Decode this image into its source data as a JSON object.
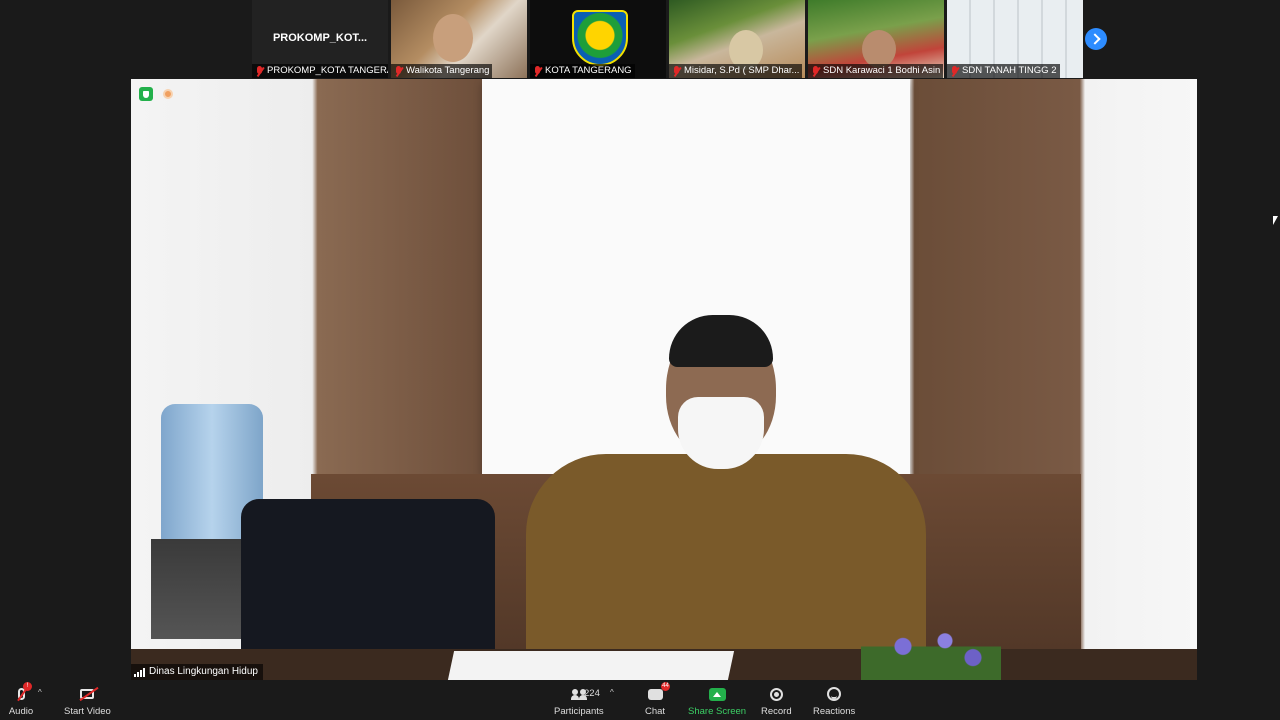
{
  "thumbnails": [
    {
      "title": "PROKOMP_KOT...",
      "name": "PROKOMP_KOTA TANGERA..."
    },
    {
      "name": "Walikota Tangerang"
    },
    {
      "name": "KOTA TANGERANG"
    },
    {
      "name": "Misidar, S.Pd ( SMP Dhar..."
    },
    {
      "name": "SDN Karawaci 1 Bodhi Asin"
    },
    {
      "name": "SDN TANAH TINGG 2"
    }
  ],
  "main_video": {
    "speaker_name": "Dinas Lingkungan Hidup"
  },
  "toolbar": {
    "audio": "Audio",
    "start_video": "Start Video",
    "participants": "Participants",
    "participants_count": "224",
    "chat": "Chat",
    "chat_badge": "44",
    "share_screen": "Share Screen",
    "record": "Record",
    "reactions": "Reactions"
  },
  "colors": {
    "accent_blue": "#2d8cff",
    "share_green": "#23b04b",
    "muted_red": "#e02828"
  }
}
